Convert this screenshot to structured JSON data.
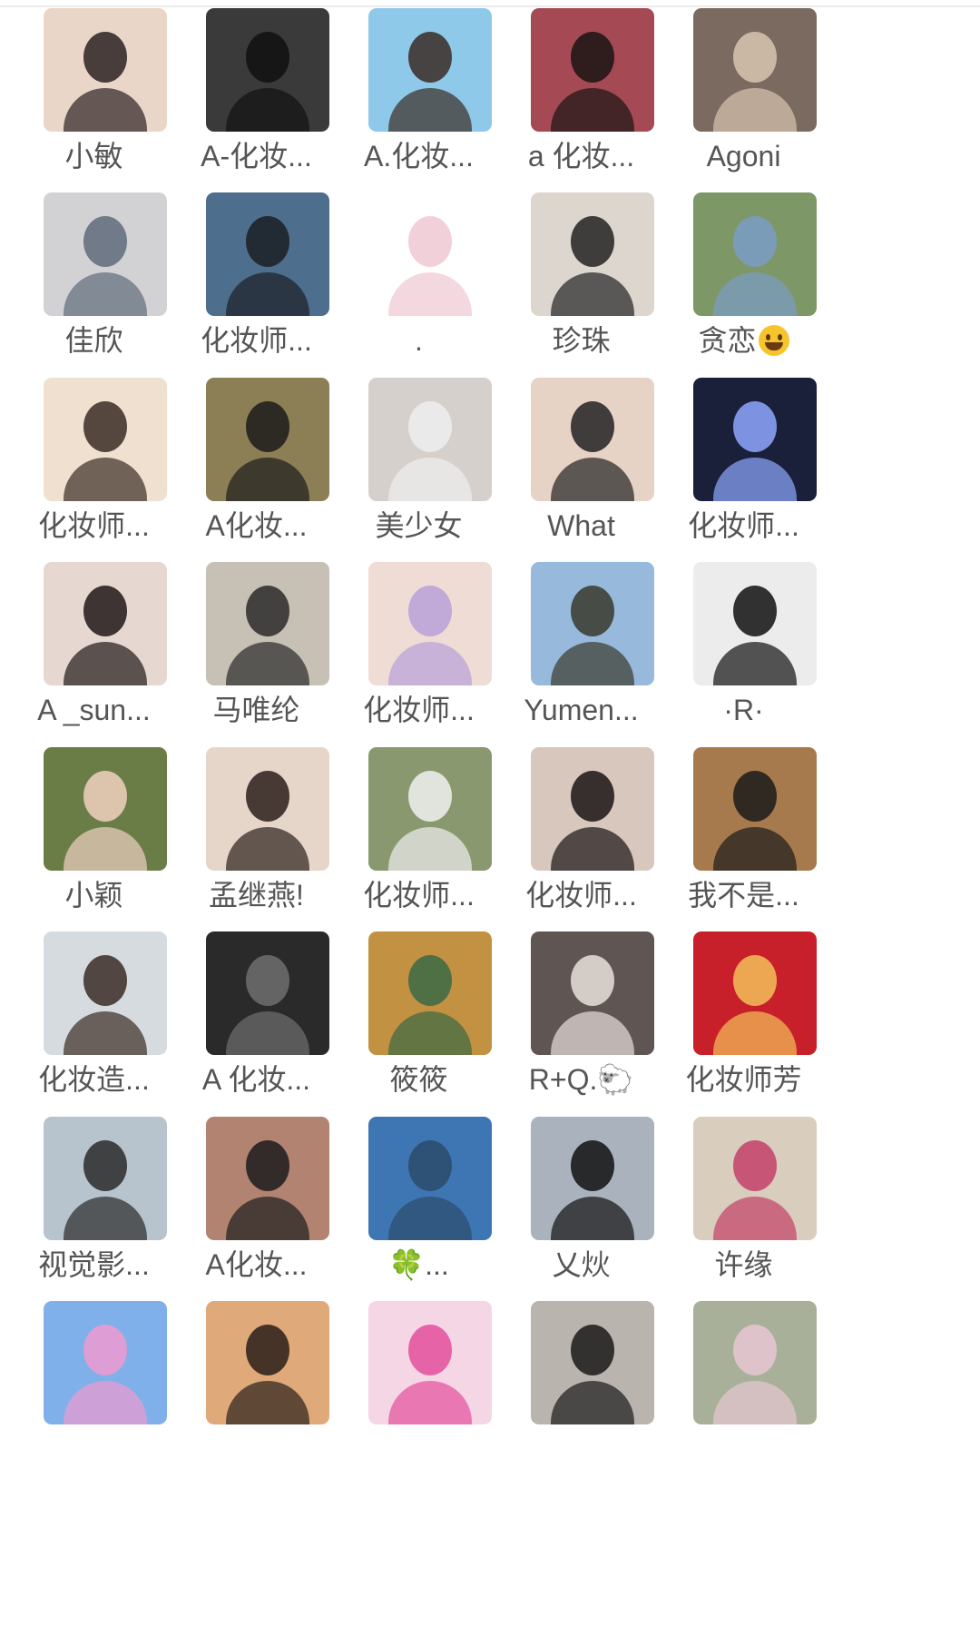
{
  "members": [
    {
      "name": "小敏",
      "bg": "#e9d6c8",
      "fg": "#2c2222"
    },
    {
      "name": "A-化妆...",
      "bg": "#3a3a3a",
      "fg": "#111111"
    },
    {
      "name": "A.化妆...",
      "bg": "#8ec9ea",
      "fg": "#3b2c24"
    },
    {
      "name": "a 化妆...",
      "bg": "#a54a54",
      "fg": "#1a1414"
    },
    {
      "name": "Agoni",
      "bg": "#7a6a60",
      "fg": "#d8c4b0"
    },
    {
      "name": "佳欣",
      "bg": "#d2d2d4",
      "fg": "#5f6b7a"
    },
    {
      "name": "化妆师...",
      "bg": "#4d6f8d",
      "fg": "#1b1e25"
    },
    {
      "name": ".",
      "bg": "#ffffff",
      "fg": "#f0c8d2"
    },
    {
      "name": "珍珠",
      "bg": "#dcd6cf",
      "fg": "#222222"
    },
    {
      "name": "贪恋",
      "bg": "#7d9866",
      "fg": "#7a9cc8",
      "emoji": "smile"
    },
    {
      "name": "化妆师...",
      "bg": "#f0e0d0",
      "fg": "#3b2c24"
    },
    {
      "name": "A化妆...",
      "bg": "#8c7f55",
      "fg": "#1b1b1b"
    },
    {
      "name": "美少女",
      "bg": "#d6d0cc",
      "fg": "#efefef"
    },
    {
      "name": "What",
      "bg": "#e7d2c6",
      "fg": "#222222"
    },
    {
      "name": "化妆师...",
      "bg": "#1a1f3a",
      "fg": "#8fa8ff"
    },
    {
      "name": "A _sun...",
      "bg": "#e6d8d0",
      "fg": "#201818"
    },
    {
      "name": "马唯纶",
      "bg": "#c7c0b5",
      "fg": "#2a2a2a"
    },
    {
      "name": "化妆师...",
      "bg": "#efdcd4",
      "fg": "#b8a0d8"
    },
    {
      "name": "Yumen...",
      "bg": "#96b9dc",
      "fg": "#3a3a2c"
    },
    {
      "name": "·R·",
      "bg": "#ececec",
      "fg": "#111111"
    },
    {
      "name": "小颖",
      "bg": "#6a7d46",
      "fg": "#f0d0c0"
    },
    {
      "name": "孟继燕!",
      "bg": "#e6d6ca",
      "fg": "#2a1f1a"
    },
    {
      "name": "化妆师...",
      "bg": "#8a9870",
      "fg": "#f0f0f0"
    },
    {
      "name": "化妆师...",
      "bg": "#d8c7bd",
      "fg": "#1a1414"
    },
    {
      "name": "我不是...",
      "bg": "#a77a4d",
      "fg": "#1b1b1b"
    },
    {
      "name": "化妆造...",
      "bg": "#d6dbe0",
      "fg": "#3a2c24"
    },
    {
      "name": "A 化妆...",
      "bg": "#2a2a2a",
      "fg": "#6f6f6f"
    },
    {
      "name": "筱筱",
      "bg": "#c29142",
      "fg": "#3b6a44"
    },
    {
      "name": "R+Q.🐑",
      "bg": "#5f5654",
      "fg": "#e8e0dc"
    },
    {
      "name": "化妆师芳",
      "bg": "#c8202a",
      "fg": "#f3c05a"
    },
    {
      "name": "视觉影...",
      "bg": "#b7c3cd",
      "fg": "#2a2a2a"
    },
    {
      "name": "A化妆...",
      "bg": "#b28370",
      "fg": "#1c1c1c"
    },
    {
      "name": "🍀...",
      "bg": "#3e76b4",
      "fg": "#2b4b6b"
    },
    {
      "name": "乂炏",
      "bg": "#aab3bd",
      "fg": "#111111"
    },
    {
      "name": "许缘",
      "bg": "#d9cdbd",
      "fg": "#c34068"
    },
    {
      "name": "",
      "bg": "#7fb0ea",
      "fg": "#ef9ad0"
    },
    {
      "name": "",
      "bg": "#e0a97a",
      "fg": "#2a1f1a"
    },
    {
      "name": "",
      "bg": "#f4d6e4",
      "fg": "#e44f9c"
    },
    {
      "name": "",
      "bg": "#b9b4ae",
      "fg": "#1a1a1a"
    },
    {
      "name": "",
      "bg": "#a8b09a",
      "fg": "#e7c7d2"
    }
  ]
}
